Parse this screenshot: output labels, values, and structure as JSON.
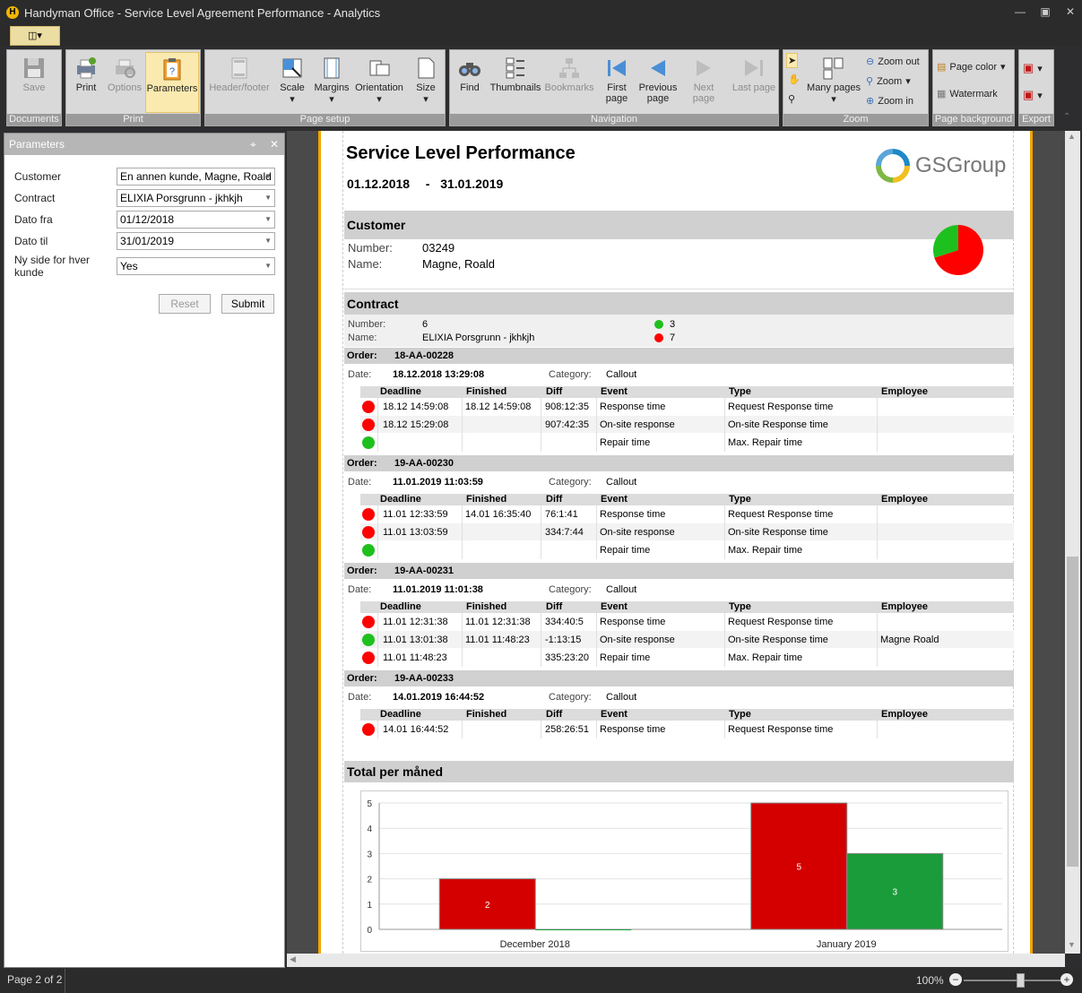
{
  "window": {
    "title": "Handyman Office - Service Level Agreement Performance - Analytics"
  },
  "ribbon": {
    "documents": {
      "label": "Documents",
      "save": "Save"
    },
    "print": {
      "label": "Print",
      "print": "Print",
      "options": "Options",
      "parameters": "Parameters"
    },
    "page_setup": {
      "label": "Page setup",
      "header_footer": "Header/footer",
      "scale": "Scale",
      "margins": "Margins",
      "orientation": "Orientation",
      "size": "Size"
    },
    "navigation": {
      "label": "Navigation",
      "find": "Find",
      "thumbnails": "Thumbnails",
      "bookmarks": "Bookmarks",
      "first_page": "First page",
      "previous_page": "Previous page",
      "next_page": "Next page",
      "last_page": "Last page"
    },
    "zoom": {
      "label": "Zoom",
      "many_pages": "Many pages",
      "zoom_out": "Zoom out",
      "zoom": "Zoom",
      "zoom_in": "Zoom in"
    },
    "page_background": {
      "label": "Page background",
      "page_color": "Page color",
      "watermark": "Watermark"
    },
    "export": {
      "label": "Export"
    }
  },
  "parameters": {
    "title": "Parameters",
    "fields": [
      {
        "label": "Customer",
        "value": "En annen kunde, Magne, Roald"
      },
      {
        "label": "Contract",
        "value": "ELIXIA Porsgrunn - jkhkjh"
      },
      {
        "label": "Dato fra",
        "value": "01/12/2018"
      },
      {
        "label": "Dato til",
        "value": "31/01/2019"
      },
      {
        "label": "Ny side for hver kunde",
        "value": "Yes"
      }
    ],
    "reset": "Reset",
    "submit": "Submit"
  },
  "report": {
    "title": "Service Level Performance",
    "date_from": "01.12.2018",
    "date_sep": "-",
    "date_to": "31.01.2019",
    "logo_text": "GSGroup",
    "customer": {
      "header": "Customer",
      "number_label": "Number:",
      "number": "03249",
      "name_label": "Name:",
      "name": "Magne, Roald"
    },
    "contract": {
      "header": "Contract",
      "number_label": "Number:",
      "number": "6",
      "name_label": "Name:",
      "name": "ELIXIA Porsgrunn - jkhkjh",
      "green_count": "3",
      "red_count": "7"
    },
    "labels": {
      "order": "Order:",
      "date": "Date:",
      "category": "Category:"
    },
    "columns": [
      "Deadline",
      "Finished",
      "Diff",
      "Event",
      "Type",
      "Employee"
    ],
    "orders": [
      {
        "id": "18-AA-00228",
        "date": "18.12.2018  13:29:08",
        "category": "Callout",
        "rows": [
          {
            "status": "red",
            "deadline": "18.12  14:59:08",
            "finished": "18.12  14:59:08",
            "diff": "908:12:35",
            "event": "Response time",
            "type": "Request Response time",
            "employee": ""
          },
          {
            "status": "red",
            "deadline": "18.12  15:29:08",
            "finished": "",
            "diff": "907:42:35",
            "event": "On-site response",
            "type": "On-site Response time",
            "employee": ""
          },
          {
            "status": "green",
            "deadline": "",
            "finished": "",
            "diff": "",
            "event": "Repair time",
            "type": "Max. Repair time",
            "employee": ""
          }
        ]
      },
      {
        "id": "19-AA-00230",
        "date": "11.01.2019  11:03:59",
        "category": "Callout",
        "rows": [
          {
            "status": "red",
            "deadline": "11.01  12:33:59",
            "finished": "14.01  16:35:40",
            "diff": "76:1:41",
            "event": "Response time",
            "type": "Request Response time",
            "employee": ""
          },
          {
            "status": "red",
            "deadline": "11.01  13:03:59",
            "finished": "",
            "diff": "334:7:44",
            "event": "On-site response",
            "type": "On-site Response time",
            "employee": ""
          },
          {
            "status": "green",
            "deadline": "",
            "finished": "",
            "diff": "",
            "event": "Repair time",
            "type": "Max. Repair time",
            "employee": ""
          }
        ]
      },
      {
        "id": "19-AA-00231",
        "date": "11.01.2019  11:01:38",
        "category": "Callout",
        "rows": [
          {
            "status": "red",
            "deadline": "11.01  12:31:38",
            "finished": "11.01  12:31:38",
            "diff": "334:40:5",
            "event": "Response time",
            "type": "Request Response time",
            "employee": ""
          },
          {
            "status": "green",
            "deadline": "11.01  13:01:38",
            "finished": "11.01  11:48:23",
            "diff": "-1:13:15",
            "event": "On-site response",
            "type": "On-site Response time",
            "employee": "Magne Roald"
          },
          {
            "status": "red",
            "deadline": "11.01  11:48:23",
            "finished": "",
            "diff": "335:23:20",
            "event": "Repair time",
            "type": "Max. Repair time",
            "employee": ""
          }
        ]
      },
      {
        "id": "19-AA-00233",
        "date": "14.01.2019  16:44:52",
        "category": "Callout",
        "rows": [
          {
            "status": "red",
            "deadline": "14.01  16:44:52",
            "finished": "",
            "diff": "258:26:51",
            "event": "Response time",
            "type": "Request Response time",
            "employee": ""
          }
        ]
      }
    ],
    "total_header": "Total per måned"
  },
  "pie": {
    "red_fraction": 0.7,
    "green_fraction": 0.3,
    "red": "#ff0000",
    "green": "#1ec01e"
  },
  "chart_data": {
    "type": "bar",
    "categories": [
      "December 2018",
      "January 2019"
    ],
    "series": [
      {
        "values": [
          2,
          5
        ],
        "color": "#d40000"
      },
      {
        "values": [
          0,
          3
        ],
        "color": "#1a9c3a"
      }
    ],
    "data_labels": [
      [
        "2",
        "5"
      ],
      [
        "",
        "3"
      ]
    ],
    "yticks": [
      "0",
      "1",
      "2",
      "3",
      "4",
      "5"
    ],
    "ylim": [
      0,
      5
    ],
    "grid": true
  },
  "status": {
    "page": "Page 2 of 2",
    "zoom": "100%",
    "zoom_fraction": 0.55
  }
}
